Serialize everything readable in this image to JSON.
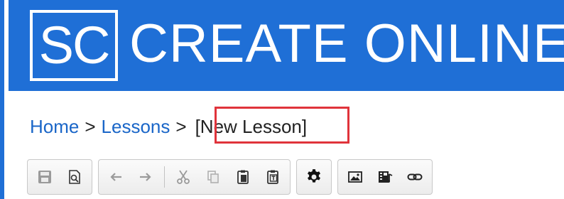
{
  "header": {
    "logo_text": "SC",
    "title": "CREATE ONLINE"
  },
  "breadcrumb": {
    "items": [
      {
        "label": "Home",
        "link": true
      },
      {
        "label": "Lessons",
        "link": true
      }
    ],
    "separator": ">",
    "current": "[New Lesson]"
  },
  "toolbar": {
    "groups": [
      [
        "save-icon",
        "preview-icon"
      ],
      [
        "undo-icon",
        "redo-icon",
        "|",
        "cut-icon",
        "copy-icon",
        "paste-icon",
        "paste-text-icon"
      ],
      [
        "settings-icon"
      ],
      [
        "image-icon",
        "media-icon",
        "link-icon"
      ]
    ]
  },
  "colors": {
    "banner": "#1f6fd6",
    "link": "#1a66c8",
    "highlight": "#e0333b"
  }
}
